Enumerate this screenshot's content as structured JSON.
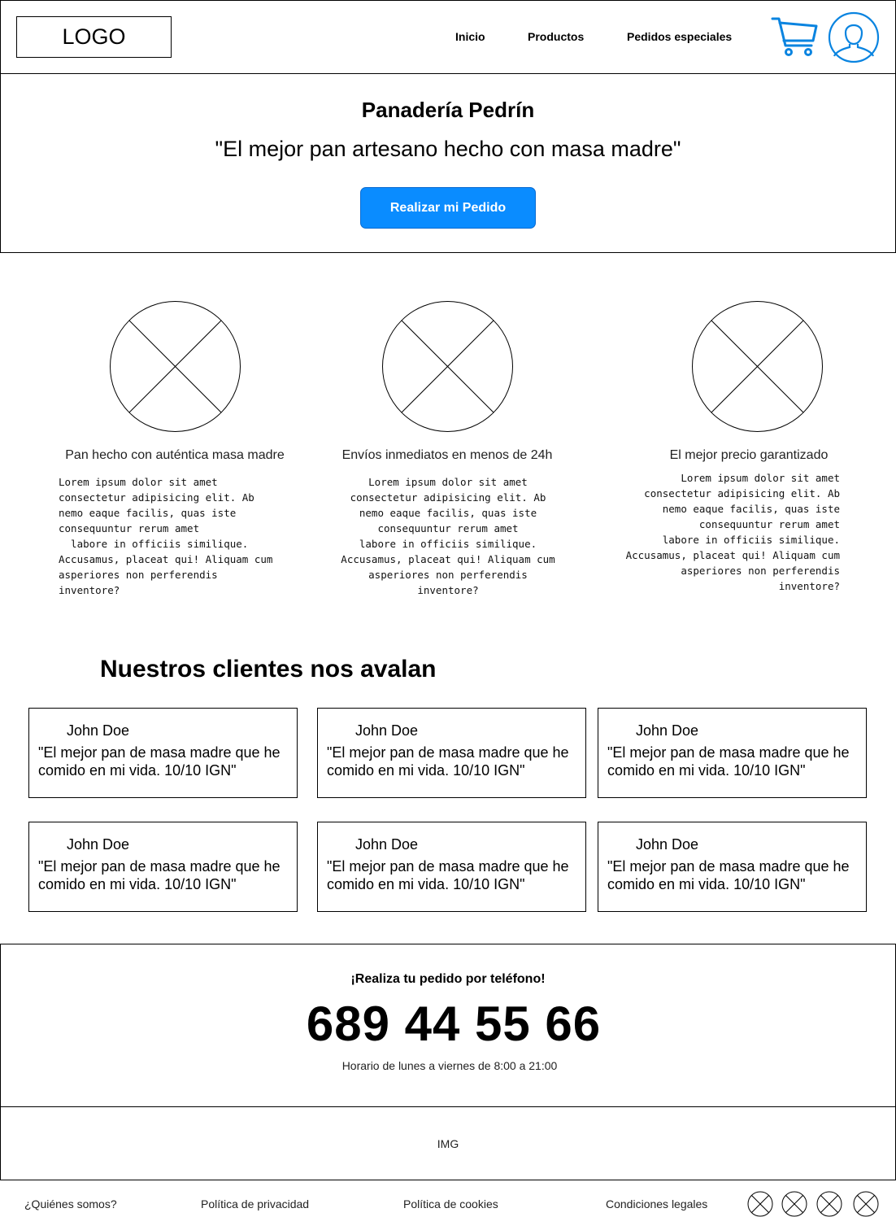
{
  "header": {
    "logo": "LOGO",
    "nav": [
      {
        "label": "Inicio"
      },
      {
        "label": "Productos"
      },
      {
        "label": "Pedidos especiales"
      }
    ],
    "icons": {
      "cart": "cart-icon",
      "user": "user-icon"
    },
    "accent_color": "#0a84e0"
  },
  "hero": {
    "title": "Panadería Pedrín",
    "slogan": "\"El mejor pan artesano hecho con masa madre\"",
    "button_label": "Realizar mi Pedido",
    "button_color": "#0a8cff"
  },
  "features": [
    {
      "title": "Pan hecho con auténtica masa madre",
      "text": "Lorem ipsum dolor sit amet\nconsectetur adipisicing elit. Ab\nnemo eaque facilis, quas iste\nconsequuntur rerum amet\n  labore in officiis similique.\nAccusamus, placeat qui! Aliquam cum\nasperiores non perferendis\ninventore?"
    },
    {
      "title": "Envíos inmediatos en menos de 24h",
      "text": "Lorem ipsum dolor sit amet\nconsectetur adipisicing elit. Ab\nnemo eaque facilis, quas iste\nconsequuntur rerum amet\nlabore in officiis similique.\nAccusamus, placeat qui! Aliquam cum\nasperiores non perferendis\ninventore?"
    },
    {
      "title": "El mejor precio garantizado",
      "text": "Lorem ipsum dolor sit amet\nconsectetur adipisicing elit. Ab\nnemo eaque facilis, quas iste\nconsequuntur rerum amet\nlabore in officiis similique.\nAccusamus, placeat qui! Aliquam cum\nasperiores non perferendis\ninventore?"
    }
  ],
  "testimonials": {
    "heading": "Nuestros clientes nos avalan",
    "items": [
      {
        "name": "John Doe",
        "quote": "\"El mejor pan de masa madre que he comido en mi vida. 10/10 IGN\""
      },
      {
        "name": "John Doe",
        "quote": "\"El mejor pan de masa madre que he comido en mi vida. 10/10 IGN\""
      },
      {
        "name": "John Doe",
        "quote": "\"El mejor pan de masa madre que he comido en mi vida. 10/10 IGN\""
      },
      {
        "name": "John Doe",
        "quote": "\"El mejor pan de masa madre que he comido en mi vida. 10/10 IGN\""
      },
      {
        "name": "John Doe",
        "quote": "\"El mejor pan de masa madre que he comido en mi vida. 10/10 IGN\""
      },
      {
        "name": "John Doe",
        "quote": "\"El mejor pan de masa madre que he comido en mi vida. 10/10 IGN\""
      }
    ]
  },
  "phone": {
    "label": "¡Realiza tu pedido por teléfono!",
    "number": "689 44 55 66",
    "hours": "Horario de lunes a viernes de 8:00 a 21:00"
  },
  "image_placeholder": "IMG",
  "footer": {
    "links": [
      {
        "label": "¿Quiénes somos?"
      },
      {
        "label": "Política de privacidad"
      },
      {
        "label": "Política de cookies"
      },
      {
        "label": "Condiciones legales"
      }
    ],
    "social_icons": [
      "social-icon-1",
      "social-icon-2",
      "social-icon-3",
      "social-icon-4"
    ]
  }
}
